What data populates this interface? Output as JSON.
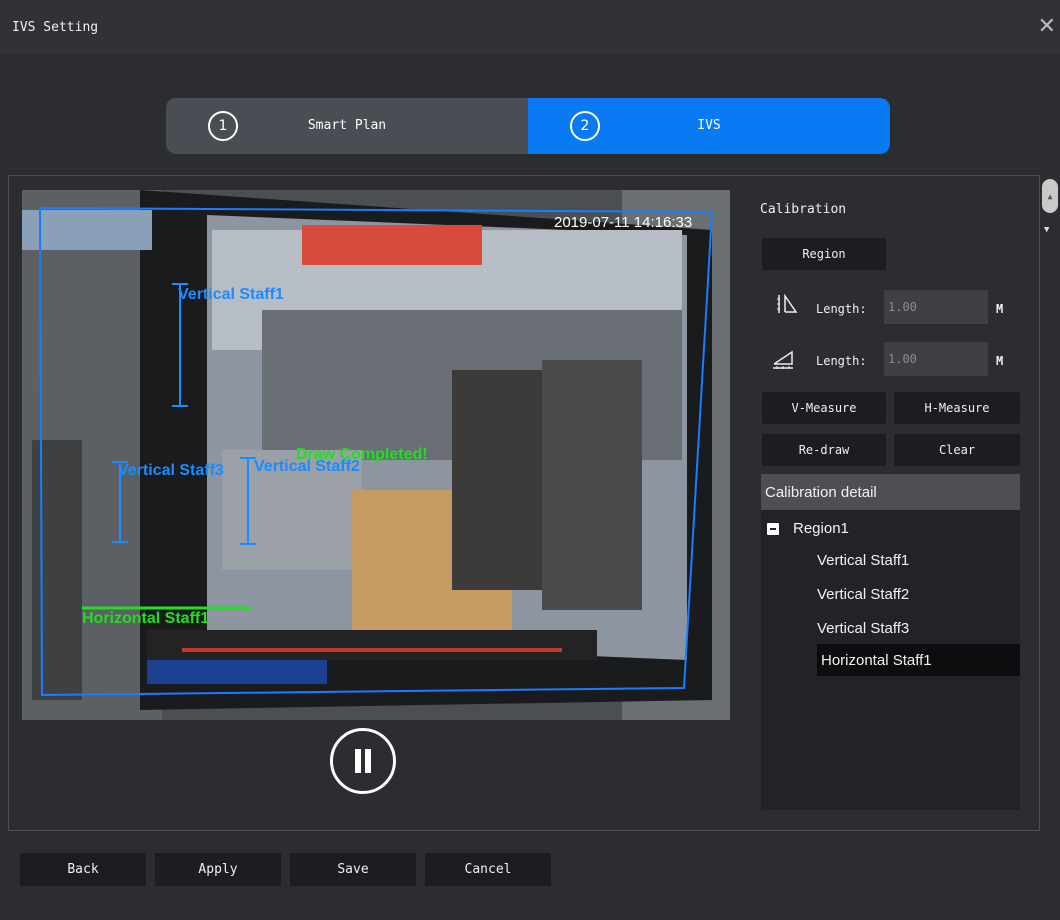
{
  "window": {
    "title": "IVS Setting"
  },
  "steps": [
    {
      "number": "1",
      "label": "Smart Plan"
    },
    {
      "number": "2",
      "label": "IVS"
    }
  ],
  "video": {
    "timestamp": "2019-07-11 14:16:33",
    "annotations": {
      "vertical_staff1": "Vertical Staff1",
      "vertical_staff3": "Vertical Staff3",
      "vertical_staff2": "Vertical Staff2",
      "draw_completed": "Draw Completed!",
      "horizontal_staff1": "Horizontal Staff1"
    },
    "colors": {
      "staff": "#1a8cff",
      "horizontal": "#22dd22",
      "region": "#1a7cff"
    }
  },
  "calibration": {
    "title": "Calibration",
    "region_button": "Region",
    "length_label": "Length:",
    "vertical_length": "1.00",
    "horizontal_length": "1.00",
    "unit": "M",
    "v_measure": "V-Measure",
    "h_measure": "H-Measure",
    "redraw": "Re-draw",
    "clear": "Clear",
    "detail_title": "Calibration detail",
    "tree_root": "Region1",
    "tree_items": [
      "Vertical Staff1",
      "Vertical Staff2",
      "Vertical Staff3",
      "Horizontal Staff1"
    ]
  },
  "footer": {
    "back": "Back",
    "apply": "Apply",
    "save": "Save",
    "cancel": "Cancel"
  },
  "colors": {
    "accent": "#0a79f4",
    "bg": "#2b2d31"
  }
}
